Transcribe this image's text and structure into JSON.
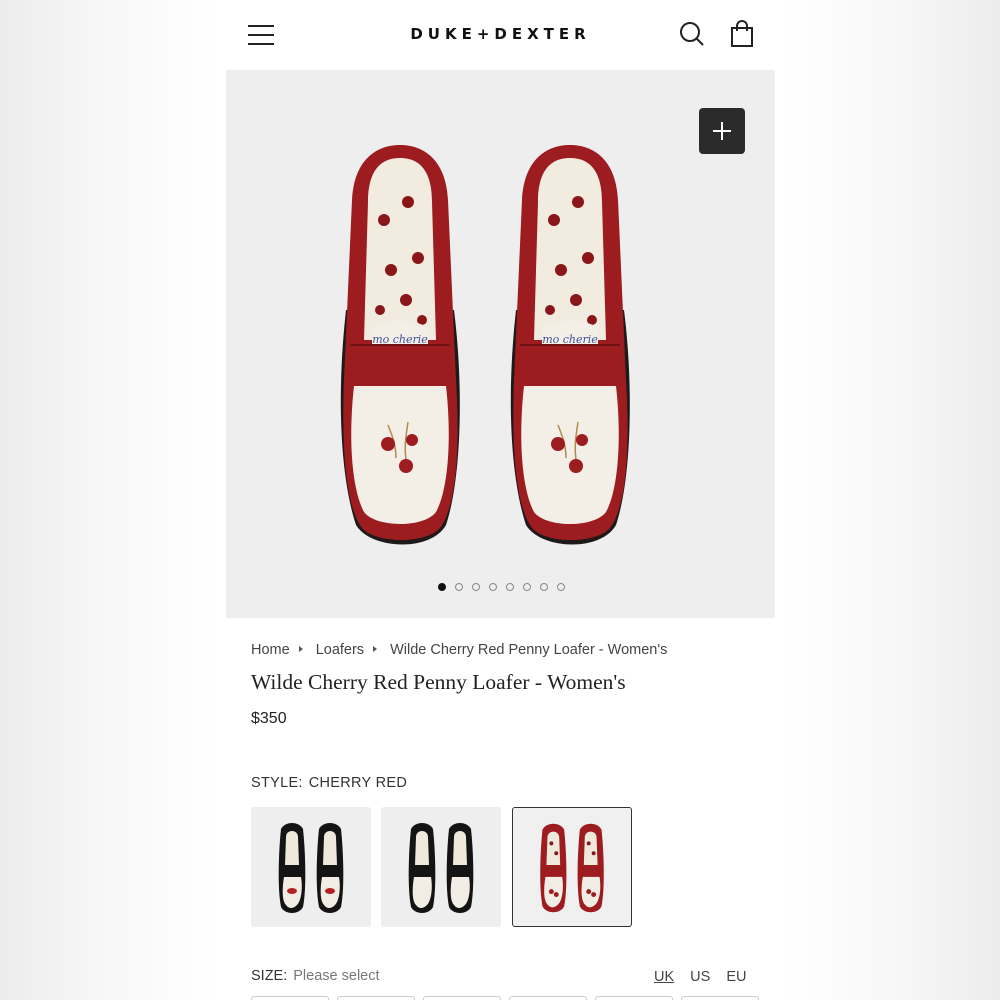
{
  "header": {
    "brand": "DUKE+DEXTER",
    "menu_icon": "hamburger-icon",
    "search_icon": "search-icon",
    "cart_icon": "shopping-bag-icon"
  },
  "gallery": {
    "zoom_icon": "plus-icon",
    "image_count": 8,
    "active_index": 0
  },
  "breadcrumb": [
    {
      "label": "Home"
    },
    {
      "label": "Loafers"
    },
    {
      "label": "Wilde Cherry Red Penny Loafer - Women's"
    }
  ],
  "product": {
    "title": "Wilde Cherry Red Penny Loafer - Women's",
    "price": "$350"
  },
  "style": {
    "label": "STYLE:",
    "value": "CHERRY RED",
    "swatches": [
      {
        "name": "black-lips",
        "color": "#111111",
        "selected": false
      },
      {
        "name": "black-white",
        "color": "#111111",
        "selected": false
      },
      {
        "name": "cherry-red",
        "color": "#9c1c1f",
        "selected": true
      }
    ]
  },
  "size": {
    "label": "SIZE:",
    "placeholder": "Please select",
    "systems": [
      "UK",
      "US",
      "EU"
    ],
    "active_system": "UK"
  },
  "colors": {
    "accent_red": "#9c1c1f",
    "cream": "#f4efe6"
  }
}
